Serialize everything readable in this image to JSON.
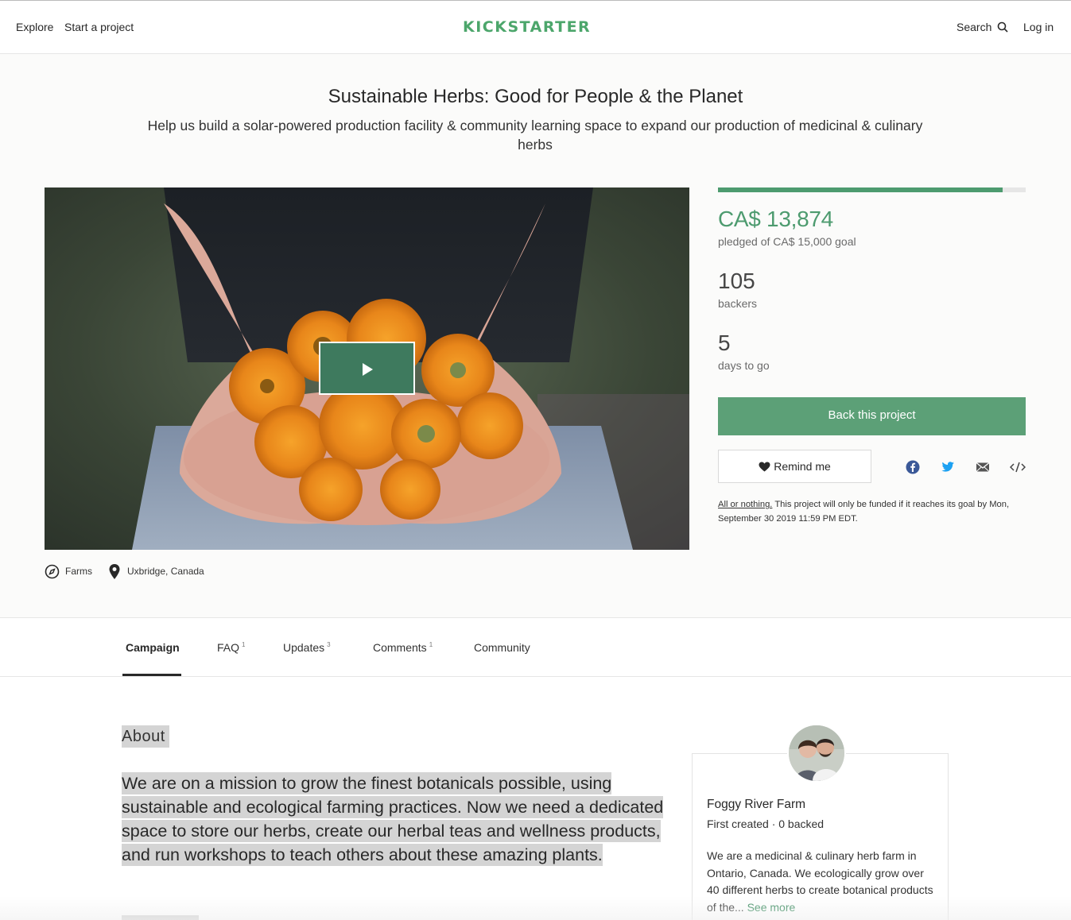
{
  "header": {
    "explore": "Explore",
    "start_project": "Start a project",
    "logo": "KICKSTARTER",
    "search": "Search",
    "login": "Log in"
  },
  "project": {
    "title": "Sustainable Herbs: Good for People & the Planet",
    "blurb": "Help us build a solar-powered production facility & community learning space to expand our production of medicinal & culinary herbs",
    "category": "Farms",
    "location": "Uxbridge, Canada"
  },
  "stats": {
    "pledged": "CA$ 13,874",
    "pledged_label": "pledged of CA$ 15,000 goal",
    "progress_fraction": 0.925,
    "backers": "105",
    "backers_label": "backers",
    "days": "5",
    "days_label": "days to go"
  },
  "actions": {
    "back_project": "Back this project",
    "remind_me": "Remind me",
    "all_or_nothing": "All or nothing.",
    "funding_note": " This project will only be funded if it reaches its goal by Mon, September 30 2019 11:59 PM EDT."
  },
  "share_icons": [
    "facebook-icon",
    "twitter-icon",
    "email-icon",
    "embed-icon"
  ],
  "tabs": [
    {
      "label": "Campaign",
      "count": ""
    },
    {
      "label": "FAQ",
      "count": "1"
    },
    {
      "label": "Updates",
      "count": "3"
    },
    {
      "label": "Comments",
      "count": "1"
    },
    {
      "label": "Community",
      "count": ""
    }
  ],
  "campaign": {
    "about_heading": "About",
    "mission": "We are on a mission to grow the finest botanicals possible, using sustainable and ecological farming practices. Now we need a dedicated space to store our herbs, create our herbal teas and wellness products, and run workshops to teach others about these amazing plants. "
  },
  "creator": {
    "name": "Foggy River Farm",
    "meta": "First created · 0 backed",
    "bio": "We are a medicinal & culinary herb farm in Ontario, Canada. We ecologically grow over 40 different herbs to create botanical products of the...",
    "see_more": "See more"
  },
  "colors": {
    "brand_green": "#4d9b6f",
    "button_green": "#5ca077",
    "play_button": "#3e7a5e"
  }
}
